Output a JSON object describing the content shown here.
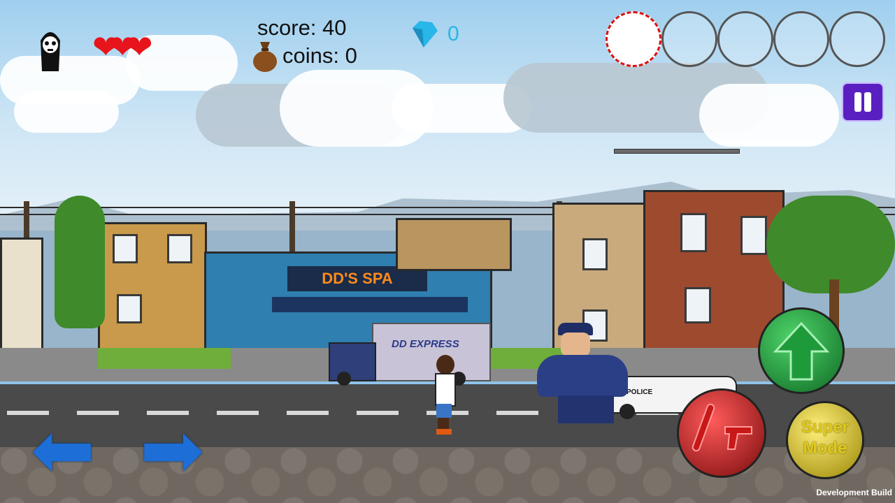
{
  "hud": {
    "score_label": "score: 40",
    "coins_label": "coins: 0",
    "gems_count": "0",
    "lives_hearts": 3,
    "weapon_slots": 5,
    "active_slot_index": 0
  },
  "scene": {
    "spa_sign": "DD'S SPA",
    "truck_label": "DD EXPRESS",
    "police_label": "POLICE"
  },
  "controls": {
    "super_mode_label": "Super Mode"
  },
  "footer": {
    "build_label": "Development Build"
  },
  "colors": {
    "heart": "#e8141b",
    "gem": "#29b6e8",
    "pause": "#5a1fc1",
    "jump": "#1f9a3a",
    "attack": "#c81818",
    "super": "#e0c91c",
    "move_arrows": "#1d6ed6"
  },
  "icons": {
    "player_avatar": "grim-reaper-icon",
    "coin_bag": "money-bag-icon",
    "gem": "diamond-icon",
    "pause": "pause-icon",
    "jump": "up-arrow-icon",
    "attack": "bat-and-gun-icon"
  }
}
